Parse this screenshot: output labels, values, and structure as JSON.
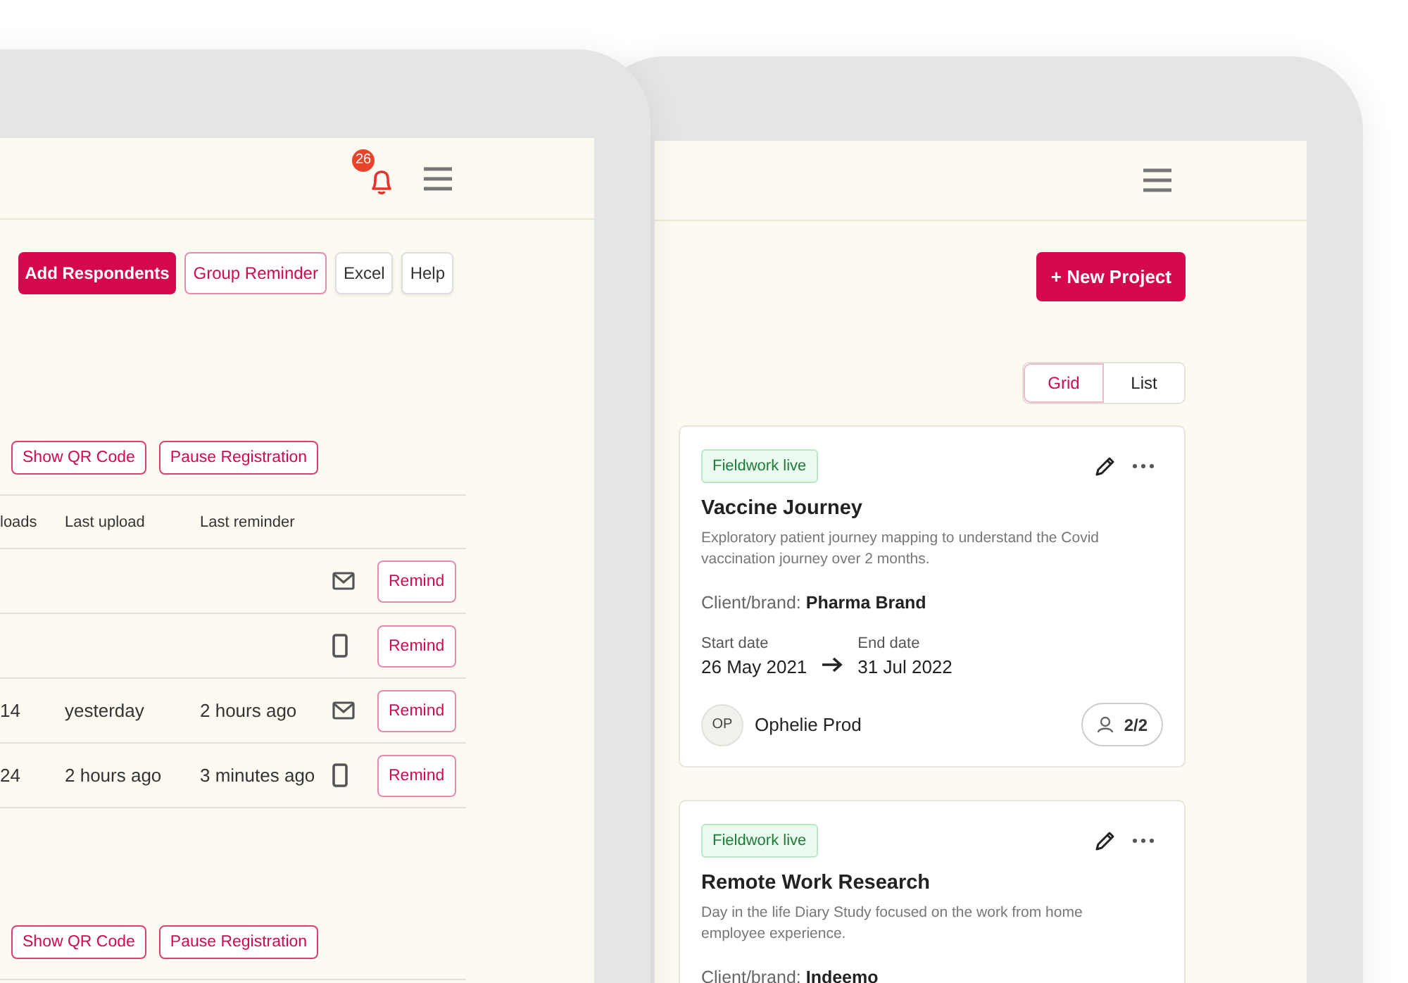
{
  "left_screen": {
    "notifications": {
      "count": "26"
    },
    "actions": [
      {
        "label": "Add Respondents",
        "kind": "primary"
      },
      {
        "label": "Group Reminder",
        "kind": "outline"
      },
      {
        "label": "Excel",
        "kind": "plain"
      },
      {
        "label": "Help",
        "kind": "plain"
      }
    ],
    "registration_actions": [
      "Show QR Code",
      "Pause Registration"
    ],
    "table": {
      "columns": [
        "loads",
        "Last upload",
        "Last reminder"
      ],
      "rows": [
        {
          "kind": "email",
          "action": "Remind"
        },
        {
          "kind": "phone",
          "action": "Remind"
        },
        {
          "uploads": "14",
          "last_upload": "yesterday",
          "last_reminder": "2 hours ago",
          "kind": "email",
          "action": "Remind"
        },
        {
          "uploads": "24",
          "last_upload": "2 hours ago",
          "last_reminder": "3 minutes ago",
          "kind": "phone",
          "action": "Remind"
        }
      ]
    },
    "registration_actions_lower": [
      "Show QR Code",
      "Pause Registration"
    ]
  },
  "right_screen": {
    "new_project_button": "+ New Project",
    "view_toggle": [
      {
        "label": "Grid",
        "selected": true
      },
      {
        "label": "List",
        "selected": false
      }
    ],
    "projects": [
      {
        "status": "Fieldwork live",
        "title": "Vaccine Journey",
        "description": "Exploratory patient journey mapping to understand the Covid vaccination journey over 2 months.",
        "client": "Client/brand: **Pharma Brand**",
        "start_label": "Start date",
        "start_date": "26 May 2021",
        "end_label": "End date",
        "end_date": "31 Jul 2022",
        "owner_initials": "OP",
        "owner": "Ophelie Prod",
        "members": "2/2"
      },
      {
        "status": "Fieldwork live",
        "title": "Remote Work Research",
        "description": "Day in the life Diary Study focused on the work from home employee experience.",
        "client": "Client/brand: **Indeemo**"
      }
    ]
  }
}
